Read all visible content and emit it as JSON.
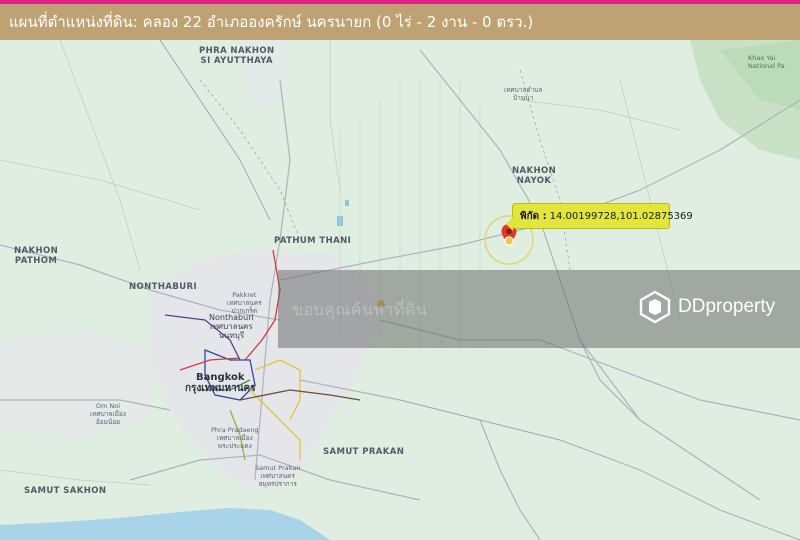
{
  "header": {
    "title": "แผนที่ตำแหน่งที่ดิน: คลอง 22 อำเภอองครักษ์ นครนายก (0 ไร่ - 2 งาน - 0 ตรว.)"
  },
  "marker": {
    "coord_label": "พิกัด :",
    "coord_value": "14.00199728,101.02875369"
  },
  "watermark": {
    "thai_text": "ขอบคุณค้นหาที่ดิน",
    "brand": "DDproperty"
  },
  "map_labels": {
    "phra_nakhon": "PHRA NAKHON\nSI AYUTTHAYA",
    "khao_yai": "Khao Yai\nNational Pa",
    "nakhon_nayok": "NAKHON\nNAYOK",
    "pathum_thani": "PATHUM THANI",
    "nakhon_pathom": "NAKHON\nPATHOM",
    "nonthaburi_prov": "NONTHABURI",
    "pakkret": "Pakkret\nเทศบาลนคร\nปากเกร็ด",
    "nonthaburi_city": "Nonthaburi\nเทศบาลนคร\nนนทบุรี",
    "bangkok": "Bangkok\nกรุงเทพมหานคร",
    "om_noi": "Om Noi\nเทศบาลเมือง\nอ้อมน้อย",
    "phra_pradaeng": "Phra Pradaeng\nเทศบาลเมือง\nพระประแดง",
    "samut_prakan_city": "Samut Prakan\nเทศบาลนคร\nสมุทรปราการ",
    "samut_prakan_prov": "SAMUT PRAKAN",
    "samut_sakhon": "SAMUT SAKHON",
    "top_village": "เทศบาลตำบล\nบ้านนา"
  },
  "colors": {
    "header_bg": "#bfa274",
    "top_accent": "#e0218a",
    "land": "#dfeee0",
    "urban": "#e4e6e9",
    "water": "#a9d3e8",
    "callout": "#e2e63a",
    "marker": "#d93a2b"
  },
  "icons": {
    "marker": "map-pin-icon",
    "brand_logo": "ddproperty-logo-icon"
  }
}
